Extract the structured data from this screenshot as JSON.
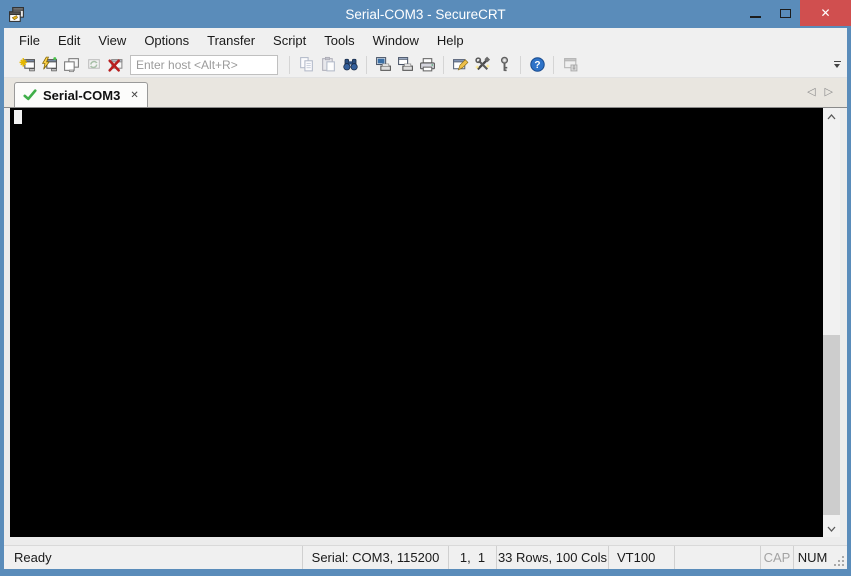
{
  "titlebar": {
    "title": "Serial-COM3 - SecureCRT",
    "app_icon": "securecrt-app-icon",
    "controls": {
      "minimize": "minimize-button",
      "maximize": "maximize-button",
      "close": "close-button"
    }
  },
  "glyphs": {
    "close": "✕",
    "tab_close": "✕",
    "tab_scroll_left": "◁",
    "tab_scroll_right": "▷"
  },
  "menu": {
    "items": [
      "File",
      "Edit",
      "View",
      "Options",
      "Transfer",
      "Script",
      "Tools",
      "Window",
      "Help"
    ]
  },
  "toolbar": {
    "host_placeholder": "Enter host <Alt+R>",
    "host_value": "",
    "icons": [
      "connect",
      "quick-connect",
      "connect-in-tab",
      "reconnect",
      "disconnect",
      "copy",
      "paste",
      "find",
      "print-screen",
      "print-selection",
      "print",
      "session-options",
      "global-options",
      "keymap",
      "help",
      "securefx",
      "toolbar-overflow"
    ],
    "disabled_icons": [
      "reconnect",
      "copy",
      "paste",
      "securefx"
    ]
  },
  "tabs": {
    "active": {
      "label": "Serial-COM3",
      "status_icon": "connected-check"
    }
  },
  "terminal": {
    "content": "",
    "cursor": "block at row 1, col 1",
    "background": "#000000",
    "cursor_color": "#f2f2f2"
  },
  "statusbar": {
    "ready": "Ready",
    "connection": "Serial: COM3, 115200",
    "cursor_position": "1,  1",
    "terminal_size": "33 Rows, 100 Cols",
    "emulation": "VT100",
    "caps_lock": "CAP",
    "num_lock": "NUM"
  },
  "colors": {
    "titlebar": "#5a8cba",
    "close_button": "#d04f4f",
    "chrome": "#f0f0f0",
    "tabbar": "#e9e6e0",
    "terminal_bg": "#000000",
    "check_green": "#3fae49",
    "scrollbar_thumb": "#cdcdcd"
  }
}
